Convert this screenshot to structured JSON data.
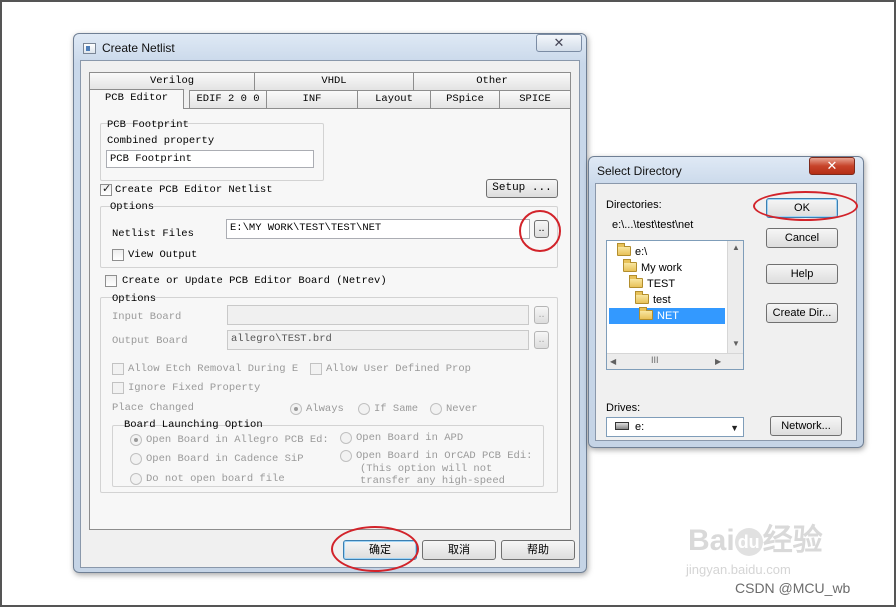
{
  "create_netlist": {
    "title": "Create Netlist",
    "close_glyph": "✕",
    "tabs_row1": [
      "Verilog",
      "VHDL",
      "Other"
    ],
    "tabs_row2": [
      "PCB Editor",
      "EDIF 2 0 0",
      "INF",
      "Layout",
      "PSpice",
      "SPICE"
    ],
    "pcb_footprint": {
      "group_label": "PCB Footprint",
      "combined_label": "Combined property",
      "value": "PCB Footprint"
    },
    "create_netlist_checkbox": "Create PCB Editor Netlist",
    "setup_button": "Setup ...",
    "options_label": "Options",
    "netlist_files_label": "Netlist Files",
    "netlist_files_value": "E:\\MY WORK\\TEST\\TEST\\NET",
    "browse_label": "..",
    "view_output_label": "View Output",
    "create_update_board": "Create or Update PCB Editor Board (Netrev)",
    "options2_label": "Options",
    "input_board_label": "Input Board",
    "input_board_value": "",
    "output_board_label": "Output Board",
    "output_board_value": "allegro\\TEST.brd",
    "allow_etch": "Allow Etch Removal During E",
    "allow_user_defined": "Allow User Defined Prop",
    "ignore_fixed": "Ignore Fixed Property",
    "place_changed_label": "Place Changed",
    "place_options": [
      "Always",
      "If Same",
      "Never"
    ],
    "board_launching_label": "Board Launching Option",
    "launch_options": [
      "Open Board in Allegro PCB Ed:",
      "Open Board in Cadence SiP",
      "Do not open board file",
      "Open Board in APD",
      "Open Board in OrCAD PCB Edi:"
    ],
    "orcad_note": [
      "(This option will not",
      "transfer any high-speed"
    ],
    "buttons": {
      "ok": "确定",
      "cancel": "取消",
      "help": "帮助"
    }
  },
  "select_directory": {
    "title": "Select Directory",
    "close_glyph": "✕",
    "directories_label": "Directories:",
    "current_path": "e:\\...\\test\\test\\net",
    "tree": [
      "e:\\",
      "My work",
      "TEST",
      "test",
      "NET"
    ],
    "scroll_thumb": "III",
    "drives_label": "Drives:",
    "drive_value": "e:",
    "buttons": {
      "ok": "OK",
      "cancel": "Cancel",
      "help": "Help",
      "create_dir": "Create Dir...",
      "network": "Network..."
    }
  },
  "watermark": {
    "baidu": "Bai",
    "baidu_du": "du",
    "baidu_cn": "经验",
    "baidu_url": "jingyan.baidu.com",
    "csdn": "CSDN @MCU_wb"
  },
  "colors": {
    "selection": "#3399ff",
    "highlight_ring": "#d2232a",
    "window_frame": "#c5d4e6"
  }
}
